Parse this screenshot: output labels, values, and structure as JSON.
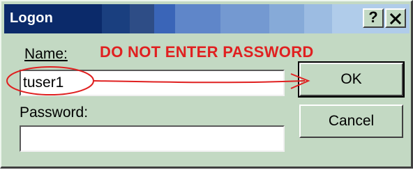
{
  "window": {
    "title": "Logon",
    "help_button": "?",
    "close_icon": "close-icon"
  },
  "form": {
    "name_label": "Name:",
    "name_value": "tuser1",
    "password_label": "Password:",
    "password_value": ""
  },
  "buttons": {
    "ok_label": "OK",
    "cancel_label": "Cancel"
  },
  "annotation": {
    "warning_text": "DO NOT ENTER PASSWORD",
    "color": "#e02020"
  },
  "colors": {
    "dialog_background": "#c3d9c3",
    "title_gradient_start": "#0b2a6a",
    "title_gradient_end": "#b0ccea"
  }
}
